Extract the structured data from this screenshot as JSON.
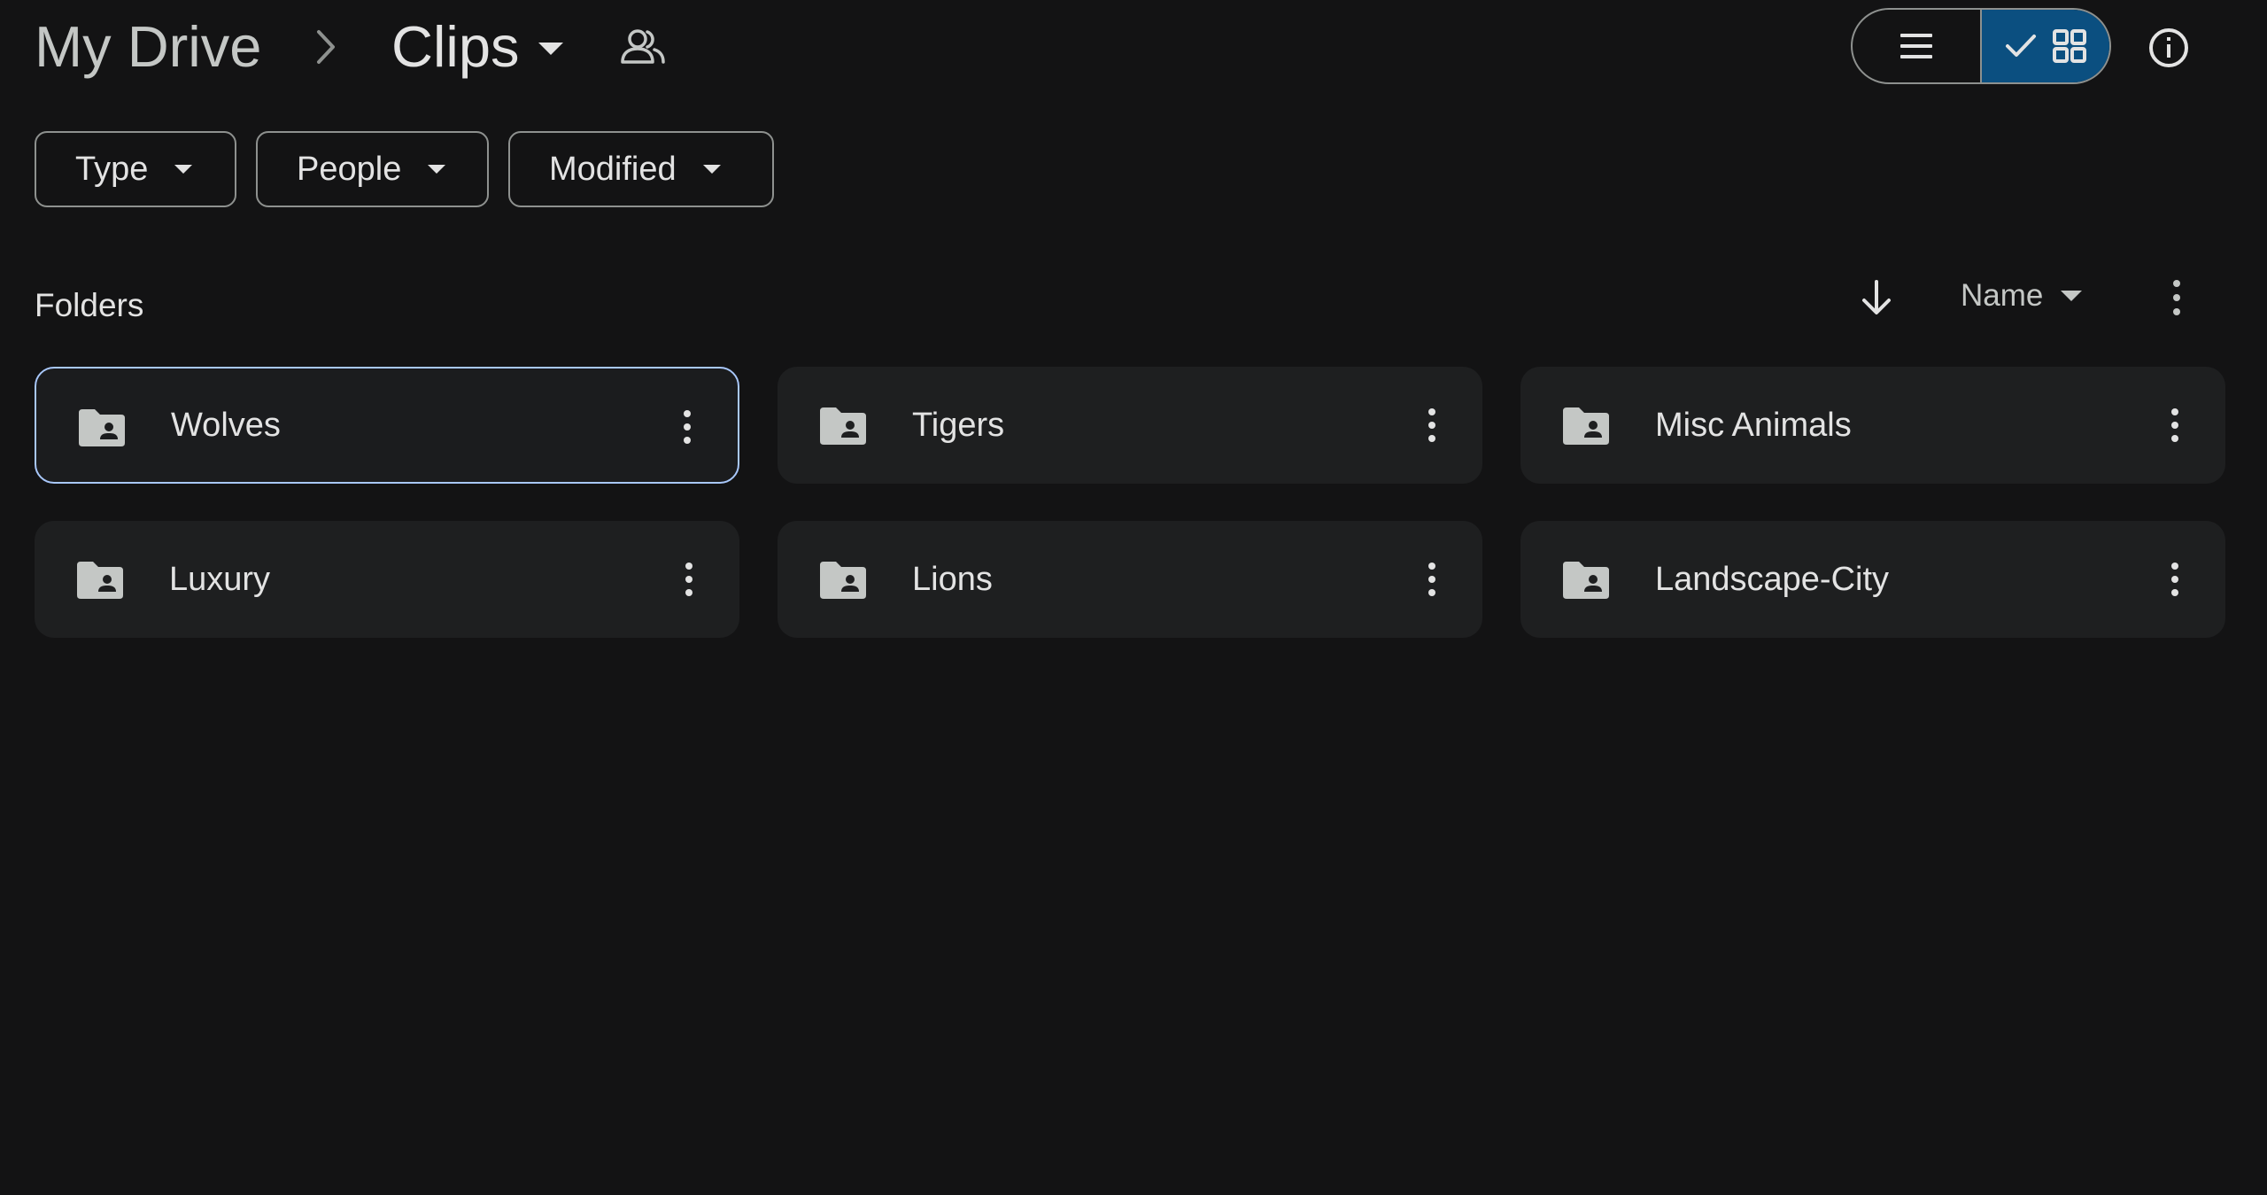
{
  "header": {
    "breadcrumb_root": "My Drive",
    "current_folder": "Clips",
    "icons": {
      "separator": "chevron-right-icon",
      "folder_menu": "caret-down-icon",
      "shared": "people-icon",
      "list_view": "list-view-icon",
      "checked": "check-icon",
      "grid_view": "grid-view-icon",
      "info": "info-icon"
    },
    "active_view": "grid"
  },
  "filters": [
    {
      "label": "Type"
    },
    {
      "label": "People"
    },
    {
      "label": "Modified"
    }
  ],
  "folders_section": {
    "title": "Folders",
    "sort_field": "Name",
    "sort_direction": "descending",
    "icons": {
      "sort": "arrow-down-icon",
      "more": "more-vert-icon"
    }
  },
  "folders": [
    {
      "name": "Wolves",
      "selected": true,
      "icon": "shared-folder-icon"
    },
    {
      "name": "Tigers",
      "selected": false,
      "icon": "shared-folder-icon"
    },
    {
      "name": "Misc Animals",
      "selected": false,
      "icon": "shared-folder-icon"
    },
    {
      "name": "Luxury",
      "selected": false,
      "icon": "shared-folder-icon"
    },
    {
      "name": "Lions",
      "selected": false,
      "icon": "shared-folder-icon"
    },
    {
      "name": "Landscape-City",
      "selected": false,
      "icon": "shared-folder-icon"
    }
  ],
  "colors": {
    "background": "#131314",
    "card": "#1e1f20",
    "selected_border": "#a8c7fa",
    "toggle_active": "#0b4f80",
    "text": "#e3e3e3"
  }
}
